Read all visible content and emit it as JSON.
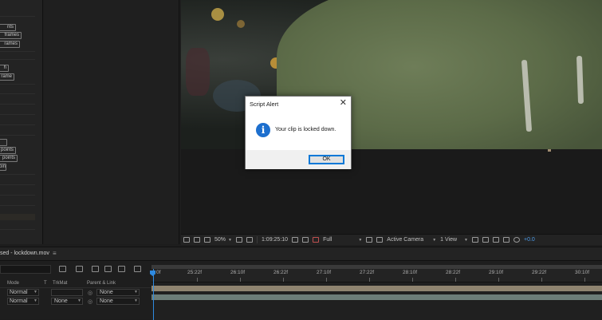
{
  "left_panel": {
    "buttons": [
      "nts",
      "frames",
      "rames",
      "h",
      "rame",
      "points",
      "points",
      "oints",
      "nts"
    ]
  },
  "viewer_toolbar": {
    "zoom": "50%",
    "timecode": "1:09:25:10",
    "resolution": "Full",
    "camera": "Active Camera",
    "views": "1 View",
    "exposure": "+0.0"
  },
  "timeline": {
    "tab_label": "sed - lockdown.mov",
    "menu_icon": "≡",
    "columns": {
      "mode": "Mode",
      "t": "T",
      "trkmat": "TrkMat",
      "parent": "Parent & Link"
    },
    "layers": [
      {
        "mode": "Normal",
        "trkmat": "",
        "parent": "None"
      },
      {
        "mode": "Normal",
        "trkmat": "None",
        "parent": "None"
      }
    ],
    "ruler_labels": [
      "0f",
      "25:22f",
      "26:10f",
      "26:22f",
      "27:10f",
      "27:22f",
      "28:10f",
      "28:22f",
      "29:10f",
      "29:22f",
      "30:10f"
    ]
  },
  "dialog": {
    "title": "Script Alert",
    "close_glyph": "✕",
    "icon_glyph": "i",
    "message": "Your clip is locked down.",
    "ok_label": "OK"
  },
  "colors": {
    "accent_blue": "#2f8ae0",
    "dialog_icon": "#1d6fce",
    "layer_bar_1": "#8f8470",
    "layer_bar_2": "#6c7d78"
  }
}
